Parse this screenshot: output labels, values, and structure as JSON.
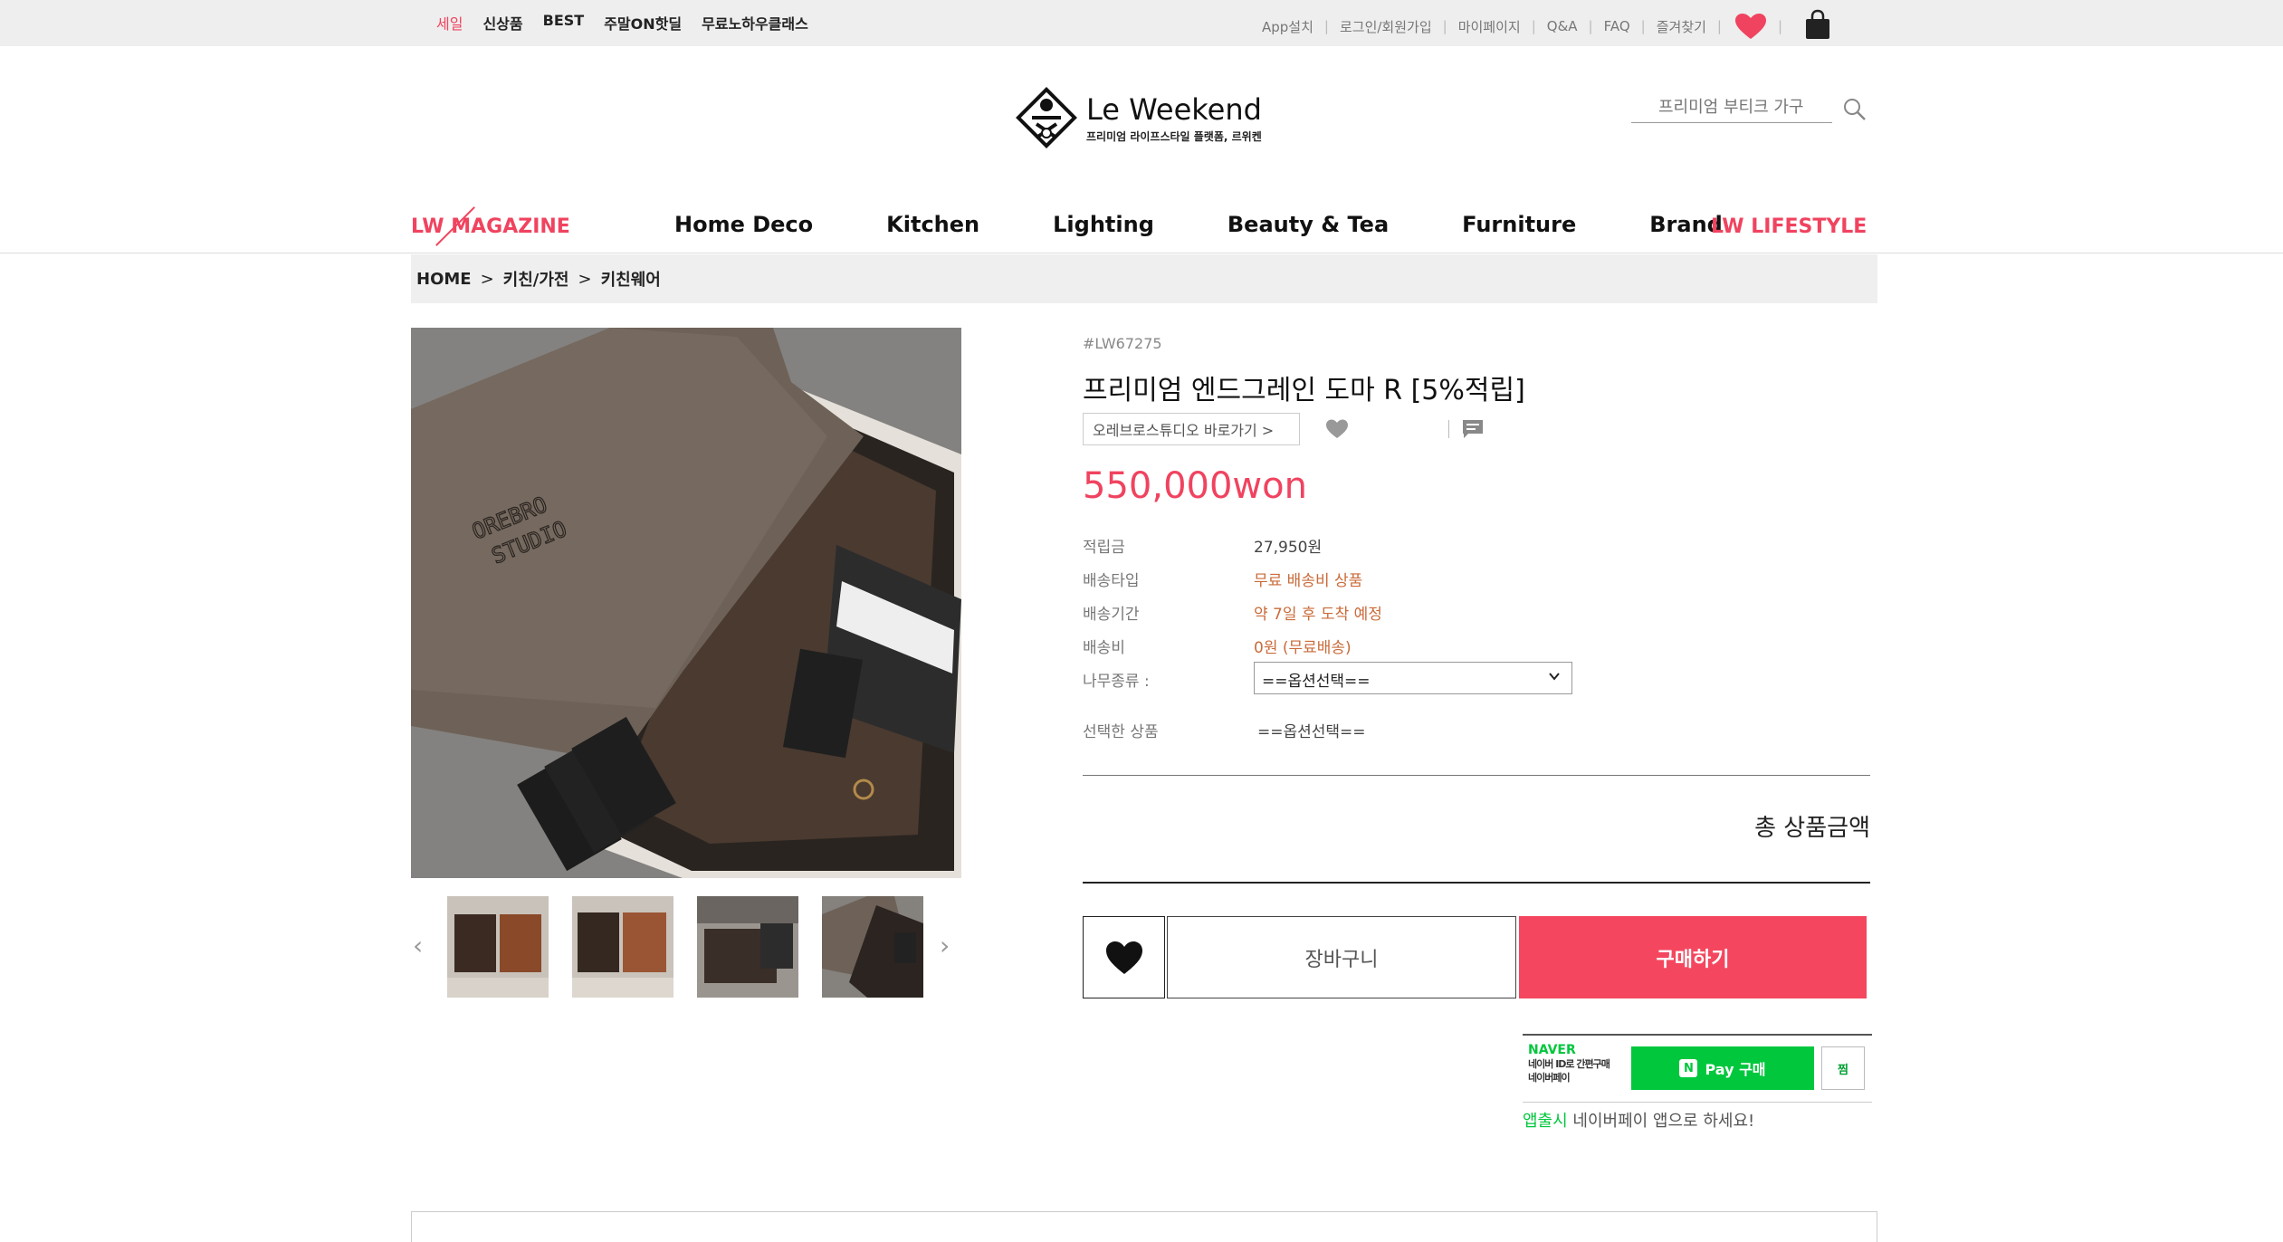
{
  "top_links": [
    "세일",
    "신상품",
    "BEST",
    "주말ON핫딜",
    "무료노하우클래스"
  ],
  "util_nav": [
    "App설치",
    "로그인/회원가입",
    "마이페이지",
    "Q&A",
    "FAQ",
    "즐겨찾기"
  ],
  "logo": {
    "title": "Le Weekend",
    "subtitle": "프리미엄 라이프스타일 플랫폼, 르위켄"
  },
  "search": {
    "placeholder": "프리미엄 부티크 가구"
  },
  "main_nav": {
    "magazine": "LW MAGAZINE",
    "items": [
      "Home Deco",
      "Kitchen",
      "Lighting",
      "Beauty & Tea",
      "Furniture",
      "Brand"
    ],
    "lifestyle": "LW LIFESTYLE"
  },
  "breadcrumb": [
    "HOME",
    "키친/가전",
    "키친웨어"
  ],
  "product": {
    "sku": "#LW67275",
    "title": "프리미엄 엔드그레인 도마 R [5%적립]",
    "brand_link": "오레브로스튜디오 바로가기 >",
    "price": "550,000won",
    "details": [
      {
        "label": "적립금",
        "value": "27,950원",
        "tone": "dark"
      },
      {
        "label": "배송타입",
        "value": "무료 배송비 상품",
        "tone": "orange"
      },
      {
        "label": "배송기간",
        "value": "약 7일 후 도착 예정",
        "tone": "orange"
      },
      {
        "label": "배송비",
        "value": "0원 (무료배송)",
        "tone": "orange"
      }
    ],
    "option_label": "나무종류 :",
    "option_selected": "==옵션선택==",
    "selected_label": "선택한 상품",
    "selected_value": "==옵션선택==",
    "total_label": "총 상품금액",
    "cart_label": "장바구니",
    "buy_label": "구매하기",
    "image_brand_text": [
      "OREBRO",
      "STUDIO"
    ]
  },
  "npay": {
    "naver": "NAVER",
    "desc1": "네이버 ID로 간편구매",
    "desc2": "네이버페이",
    "button": "Pay 구매",
    "n": "N",
    "zzim": "찜",
    "note_highlight": "앱출시",
    "note_rest": " 네이버페이 앱으로 하세요!"
  },
  "colors": {
    "accent": "#f0435f",
    "buy": "#f4475f",
    "naver": "#00c73c",
    "orange_text": "#c96b3a"
  }
}
